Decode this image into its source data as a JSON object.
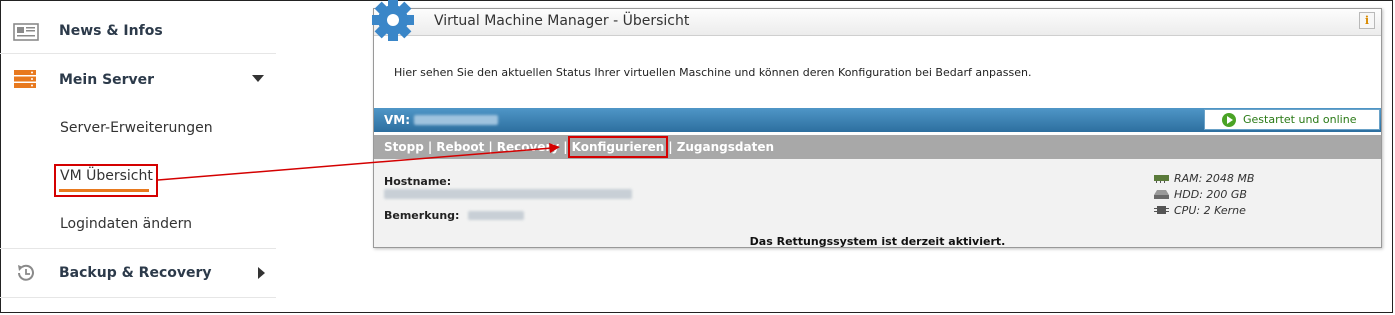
{
  "sidebar": {
    "items": [
      {
        "label": "News & Infos",
        "icon": "newspaper-icon"
      },
      {
        "label": "Mein Server",
        "icon": "server-icon"
      },
      {
        "label": "Backup & Recovery",
        "icon": "restore-icon"
      }
    ],
    "sub_items": [
      {
        "label": "Server-Erweiterungen"
      },
      {
        "label": "VM Übersicht",
        "active": true
      },
      {
        "label": "Logindaten ändern"
      }
    ]
  },
  "panel": {
    "title": "Virtual Machine Manager - Übersicht",
    "info_label": "i",
    "intro": "Hier sehen Sie den aktuellen Status Ihrer virtuellen Maschine und können deren Konfiguration bei Bedarf anpassen.",
    "vm_label": "VM:",
    "status": "Gestartet und online",
    "actions": [
      "Stopp",
      "Reboot",
      "Recovery",
      "Konfigurieren",
      "Zugangsdaten"
    ],
    "action_separator": "|",
    "hostname_label": "Hostname:",
    "remark_label": "Bemerkung:",
    "specs": {
      "ram": "RAM: 2048 MB",
      "hdd": "HDD: 200 GB",
      "cpu": "CPU: 2 Kerne"
    },
    "rescue_notice": "Das Rettungssystem ist derzeit aktiviert."
  },
  "colors": {
    "accent_orange": "#e8791e",
    "highlight_red": "#d40000",
    "vm_bar_blue": "#2d6f9f",
    "status_green": "#4aa325"
  }
}
